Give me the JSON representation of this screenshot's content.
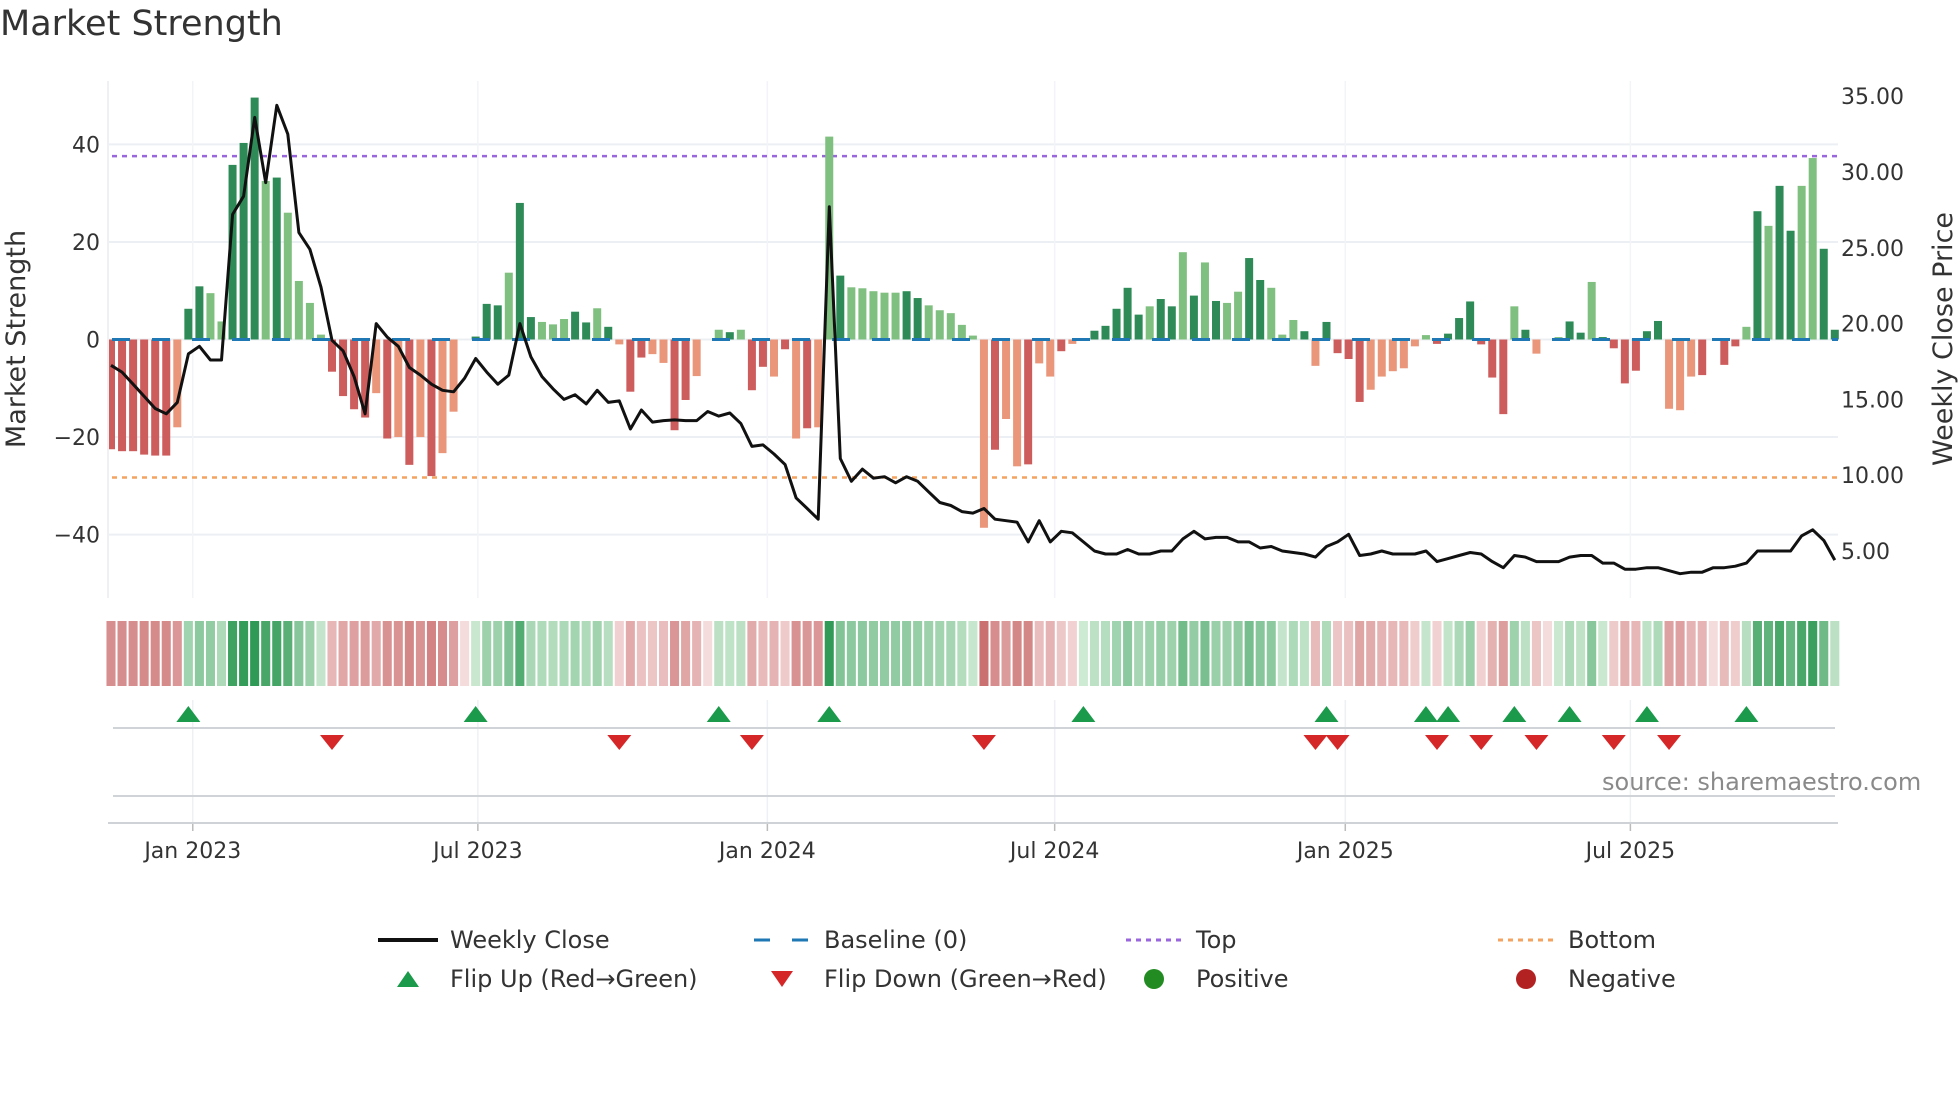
{
  "title": "Market Strength",
  "source": "source: sharemaestro.com",
  "colors": {
    "green_dark": "#2e8b57",
    "green_light": "#7fbf7f",
    "red_dark": "#cd5c5c",
    "red_light": "#e9967a",
    "line": "#111111",
    "baseline": "#1f77b4",
    "top": "#9966dd",
    "bottom": "#f4a460",
    "flip_up": "#1a9a4a",
    "flip_down": "#d62728",
    "positive": "#228b22",
    "negative": "#b22222"
  },
  "legend": {
    "weekly_close": "Weekly Close",
    "baseline": "Baseline (0)",
    "top": "Top",
    "bottom": "Bottom",
    "flip_up": "Flip Up (Red→Green)",
    "flip_down": "Flip Down (Green→Red)",
    "positive": "Positive",
    "negative": "Negative"
  },
  "chart_data": {
    "type": "bar",
    "title": "Market Strength",
    "ylabel": "Market Strength",
    "y2label": "Weekly Close Price",
    "ylim": [
      -53,
      53
    ],
    "y2lim": [
      1.9,
      36
    ],
    "yticks": [
      {
        "v": 40,
        "label": "40"
      },
      {
        "v": 20,
        "label": "20"
      },
      {
        "v": 0,
        "label": "0"
      },
      {
        "v": -20,
        "label": "−20"
      },
      {
        "v": -40,
        "label": "−40"
      }
    ],
    "y2ticks": [
      {
        "v": 35,
        "label": "35.00"
      },
      {
        "v": 30,
        "label": "30.00"
      },
      {
        "v": 25,
        "label": "25.00"
      },
      {
        "v": 20,
        "label": "20.00"
      },
      {
        "v": 15,
        "label": "15.00"
      },
      {
        "v": 10,
        "label": "10.00"
      },
      {
        "v": 5,
        "label": "5.00"
      }
    ],
    "xticks": [
      {
        "week": 8.4,
        "label": "Jan 2023"
      },
      {
        "week": 34.2,
        "label": "Jul 2023"
      },
      {
        "week": 60.4,
        "label": "Jan 2024"
      },
      {
        "week": 86.4,
        "label": "Jul 2024"
      },
      {
        "week": 112.7,
        "label": "Jan 2025"
      },
      {
        "week": 138.5,
        "label": "Jul 2025"
      }
    ],
    "top_level": 37.6,
    "bottom_level": -28.3,
    "baseline": 0,
    "strength": [
      -22.5,
      -22.9,
      -22.9,
      -23.6,
      -23.8,
      -23.8,
      -18,
      6.3,
      10.9,
      9.5,
      3.7,
      35.8,
      40.3,
      49.6,
      32.5,
      33.2,
      26,
      12,
      7.5,
      1,
      -6.6,
      -11.6,
      -14.3,
      -16,
      -11,
      -20.3,
      -20,
      -25.7,
      -20,
      -28,
      -23.3,
      -14.8,
      0,
      0.6,
      7.3,
      7,
      13.7,
      28,
      4.6,
      3.6,
      3.1,
      4.2,
      5.7,
      3.5,
      6.4,
      2.6,
      -1,
      -10.7,
      -3.7,
      -3,
      -4.8,
      -18.6,
      -12.4,
      -7.5,
      0,
      2,
      1.5,
      2,
      -10.4,
      -5.6,
      -7.6,
      -2,
      -20.3,
      -18.2,
      -18,
      41.6,
      13.1,
      10.7,
      10.5,
      9.9,
      9.6,
      9.6,
      9.9,
      8.5,
      7,
      6,
      5.4,
      3,
      0.8,
      -38.6,
      -22.6,
      -16.3,
      -26,
      -25.6,
      -4.9,
      -7.6,
      -2.4,
      -0.9,
      0.3,
      1.8,
      2.8,
      6.3,
      10.6,
      5.1,
      6.8,
      8.3,
      6.8,
      17.9,
      9,
      15.8,
      7.9,
      7.5,
      9.8,
      16.7,
      12.2,
      10.6,
      1,
      4,
      1.7,
      -5.4,
      3.6,
      -2.8,
      -4,
      -12.8,
      -10.3,
      -7.6,
      -6.5,
      -5.9,
      -1.4,
      0.9,
      -0.9,
      1.2,
      4.4,
      7.8,
      -1,
      -7.8,
      -15.3,
      6.8,
      2,
      -2.9,
      0,
      0.5,
      3.7,
      1.4,
      11.8,
      0.5,
      -1.8,
      -9,
      -6.4,
      1.7,
      3.8,
      -14.2,
      -14.5,
      -7.6,
      -7.3,
      0,
      -5.2,
      -1.4,
      2.6,
      26.3,
      23.3,
      31.5,
      22.3,
      31.5,
      37.2,
      18.6,
      2
    ],
    "shade": "ddddddlddlldddldllllddddldldldllddddlddlllddldlddllddllldlddldldlldlllllddlllllldlldlldlldddddlddldldllddllldlddddlllllldddddddldldlddlddddddllldlddldlddll",
    "weekly_close": [
      17.25,
      16.8,
      16.0,
      15.2,
      14.4,
      14.05,
      14.8,
      18.0,
      18.5,
      17.6,
      17.6,
      27.2,
      28.4,
      33.6,
      29.3,
      34.4,
      32.5,
      26.0,
      24.9,
      22.4,
      18.9,
      18.2,
      16.5,
      14.05,
      20.0,
      19.1,
      18.5,
      17.1,
      16.6,
      16.0,
      15.6,
      15.5,
      16.4,
      17.7,
      16.8,
      16.0,
      16.6,
      20.0,
      17.8,
      16.5,
      15.7,
      15.0,
      15.3,
      14.7,
      15.6,
      14.8,
      14.9,
      13.05,
      14.3,
      13.5,
      13.6,
      13.65,
      13.6,
      13.6,
      14.2,
      13.9,
      14.1,
      13.4,
      11.9,
      12.0,
      11.4,
      10.7,
      8.5,
      7.8,
      7.1,
      27.7,
      11.1,
      9.6,
      10.4,
      9.8,
      9.9,
      9.5,
      9.9,
      9.6,
      8.9,
      8.2,
      8.0,
      7.6,
      7.5,
      7.8,
      7.1,
      7.0,
      6.9,
      5.6,
      7.0,
      5.6,
      6.3,
      6.2,
      5.6,
      5.0,
      4.8,
      4.8,
      5.1,
      4.8,
      4.8,
      5.0,
      5.0,
      5.8,
      6.3,
      5.8,
      5.9,
      5.9,
      5.6,
      5.6,
      5.2,
      5.3,
      5.0,
      4.9,
      4.8,
      4.6,
      5.3,
      5.6,
      6.1,
      4.7,
      4.8,
      5.0,
      4.8,
      4.8,
      4.8,
      5.0,
      4.3,
      4.5,
      4.7,
      4.9,
      4.8,
      4.3,
      3.9,
      4.7,
      4.6,
      4.3,
      4.3,
      4.3,
      4.6,
      4.7,
      4.7,
      4.2,
      4.2,
      3.8,
      3.8,
      3.9,
      3.9,
      3.7,
      3.5,
      3.6,
      3.6,
      3.9,
      3.9,
      4.0,
      4.2,
      5.0,
      5.0,
      5.0,
      5.0,
      6.0,
      6.4,
      5.7,
      4.4
    ],
    "flip_up_weeks": [
      8,
      34,
      56,
      66,
      89,
      111,
      120,
      122,
      128,
      133,
      140,
      149
    ],
    "flip_down_weeks": [
      21,
      47,
      59,
      80,
      110,
      112,
      121,
      125,
      130,
      137,
      142
    ]
  }
}
